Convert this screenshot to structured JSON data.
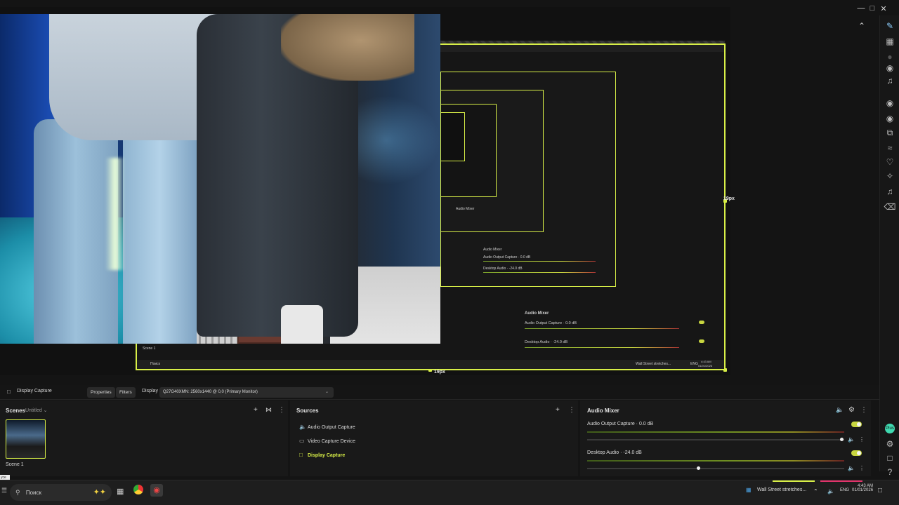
{
  "preview": {
    "nested_labels": {
      "scene_1": "Scene 1",
      "display_capture": "Display Capture",
      "audio_mixer": "Audio Mixer",
      "audio_output_capture": "Audio Output Capture · 0.0 dB",
      "desktop_audio": "Desktop Audio · -24.0 dB",
      "search": "Поиск",
      "news": "Wall Street stretches...",
      "lang": "ENG",
      "time": "4:43 AM",
      "date": "01/01/2026",
      "px_bottom": "19px",
      "px_right": "19px"
    }
  },
  "properties_bar": {
    "source_name": "Display Capture",
    "properties_label": "Properties",
    "filters_label": "Filters",
    "display_label": "Display",
    "display_value": "Q27G40XMN: 2560x1440 @ 0,0 (Primary Monitor)"
  },
  "scenes": {
    "title": "Scenes",
    "collection": "Untitled",
    "items": [
      {
        "label": "Scene 1"
      }
    ]
  },
  "sources": {
    "title": "Sources",
    "items": [
      {
        "label": "Audio Output Capture",
        "icon": "speaker-icon"
      },
      {
        "label": "Video Capture Device",
        "icon": "camera-icon"
      },
      {
        "label": "Display Capture",
        "icon": "display-icon",
        "active": true
      }
    ]
  },
  "audio_mixer": {
    "title": "Audio Mixer",
    "channels": [
      {
        "name": "Audio Output Capture",
        "level": "0.0 dB",
        "enabled": true,
        "volume_fraction": 1.0
      },
      {
        "name": "Desktop Audio",
        "level": "-24.0 dB",
        "enabled": true,
        "volume_fraction": 0.43
      }
    ]
  },
  "taskbar": {
    "search_placeholder": "Поиск",
    "news": "Wall Street stretches...",
    "language": "ENG",
    "time": "4:43 AM",
    "date": "01/01/2026",
    "tooltip": "усе"
  },
  "colors": {
    "accent": "#d8ef47",
    "panel_bg": "#191919",
    "app_bg": "#141414"
  }
}
